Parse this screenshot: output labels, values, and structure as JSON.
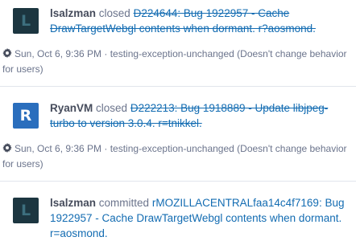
{
  "colors": {
    "link": "#136cb2",
    "author": "#464c5c",
    "muted": "#6b748c",
    "avatar_l_bg": "#1c3640",
    "avatar_l_fg": "#3d6f7e",
    "avatar_r_bg": "#2a6ebd",
    "separator": "#e1e5ec"
  },
  "stories": [
    {
      "avatar_letter": "L",
      "author": "lsalzman",
      "action": "closed",
      "object": "D224644: Bug 1922957 - Cache DrawTargetWebgl contents when dormant. r?aosmond.",
      "meta_icon": "gear-icon",
      "meta": "Sun, Oct 6, 9:36 PM · testing-exception-unchanged (Doesn't change behavior for users)"
    },
    {
      "avatar_letter": "R",
      "author": "RyanVM",
      "action": "closed",
      "object": "D222213: Bug 1918889 - Update libjpeg-turbo to version 3.0.4. r=tnikkel.",
      "meta_icon": "gear-icon",
      "meta": "Sun, Oct 6, 9:36 PM · testing-exception-unchanged (Doesn't change behavior for users)"
    },
    {
      "avatar_letter": "L",
      "author": "lsalzman",
      "action": "committed",
      "object": "rMOZILLACENTRALfaa14c4f7169: Bug 1922957 - Cache DrawTargetWebgl contents when dormant. r=aosmond."
    }
  ]
}
